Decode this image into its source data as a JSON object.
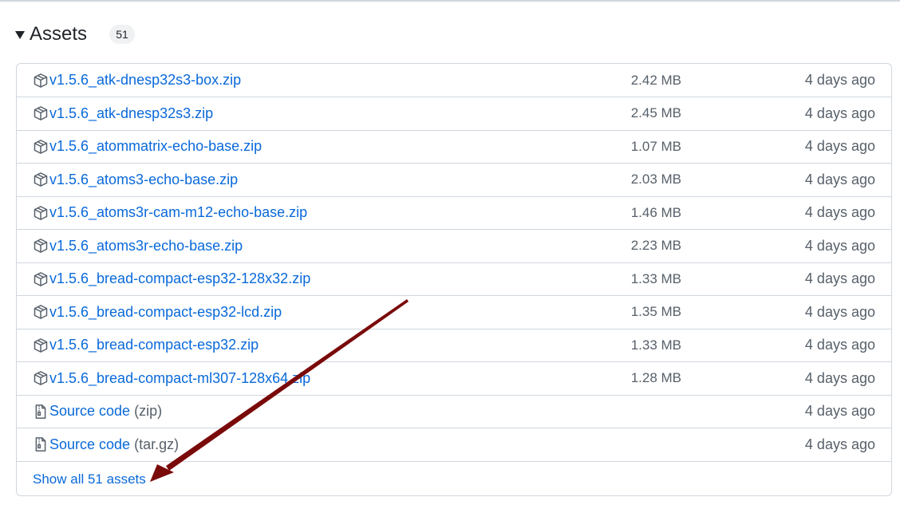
{
  "assets": {
    "title": "Assets",
    "count": "51",
    "items": [
      {
        "name": "v1.5.6_atk-dnesp32s3-box.zip",
        "size": "2.42 MB",
        "date": "4 days ago",
        "icon": "package-icon"
      },
      {
        "name": "v1.5.6_atk-dnesp32s3.zip",
        "size": "2.45 MB",
        "date": "4 days ago",
        "icon": "package-icon"
      },
      {
        "name": "v1.5.6_atommatrix-echo-base.zip",
        "size": "1.07 MB",
        "date": "4 days ago",
        "icon": "package-icon"
      },
      {
        "name": "v1.5.6_atoms3-echo-base.zip",
        "size": "2.03 MB",
        "date": "4 days ago",
        "icon": "package-icon"
      },
      {
        "name": "v1.5.6_atoms3r-cam-m12-echo-base.zip",
        "size": "1.46 MB",
        "date": "4 days ago",
        "icon": "package-icon"
      },
      {
        "name": "v1.5.6_atoms3r-echo-base.zip",
        "size": "2.23 MB",
        "date": "4 days ago",
        "icon": "package-icon"
      },
      {
        "name": "v1.5.6_bread-compact-esp32-128x32.zip",
        "size": "1.33 MB",
        "date": "4 days ago",
        "icon": "package-icon"
      },
      {
        "name": "v1.5.6_bread-compact-esp32-lcd.zip",
        "size": "1.35 MB",
        "date": "4 days ago",
        "icon": "package-icon"
      },
      {
        "name": "v1.5.6_bread-compact-esp32.zip",
        "size": "1.33 MB",
        "date": "4 days ago",
        "icon": "package-icon"
      },
      {
        "name": "v1.5.6_bread-compact-ml307-128x64.zip",
        "size": "1.28 MB",
        "date": "4 days ago",
        "icon": "package-icon"
      }
    ],
    "source_code": [
      {
        "label": "Source code",
        "format": "(zip)",
        "date": "4 days ago",
        "icon": "file-zip-icon"
      },
      {
        "label": "Source code",
        "format": "(tar.gz)",
        "date": "4 days ago",
        "icon": "file-zip-icon"
      }
    ],
    "show_all_label": "Show all 51 assets"
  },
  "colors": {
    "link": "#0969da",
    "muted": "#57606a",
    "border": "#d0d7de",
    "annotation_arrow": "#7a0a0a"
  }
}
